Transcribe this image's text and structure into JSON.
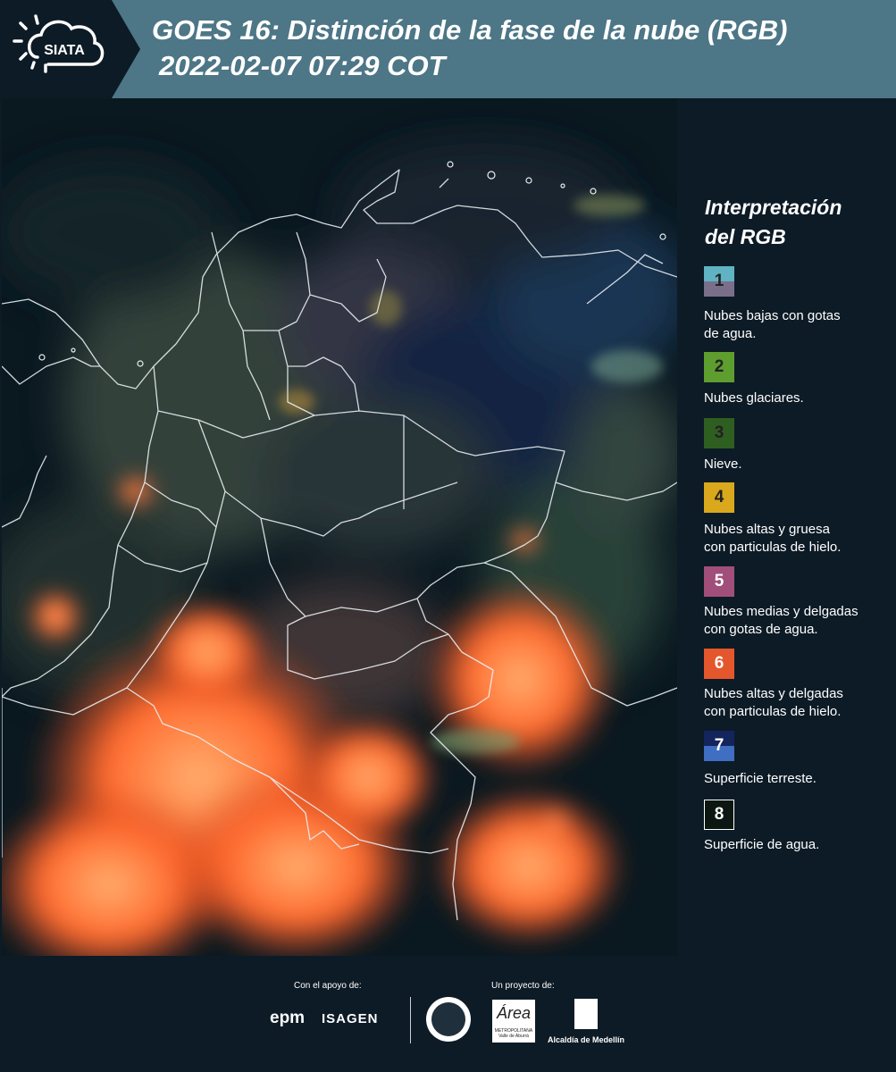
{
  "header": {
    "logo_text": "SIATA",
    "title_line1": "GOES 16: Distinción de la fase de la nube (RGB)",
    "title_line2": "2022-02-07 07:29 COT"
  },
  "legend": {
    "title_line1": "Interpretación",
    "title_line2": "del RGB",
    "items": [
      {
        "number": "1",
        "label_lines": [
          "Nubes bajas con gotas",
          "de agua."
        ],
        "colors": [
          "#5fb3c2",
          "#7a6f8b"
        ]
      },
      {
        "number": "2",
        "label_lines": [
          "Nubes glaciares."
        ],
        "colors": [
          "#5e9e2e"
        ]
      },
      {
        "number": "3",
        "label_lines": [
          "Nieve."
        ],
        "colors": [
          "#2f5e21"
        ]
      },
      {
        "number": "4",
        "label_lines": [
          "Nubes altas y gruesa",
          "con particulas de hielo."
        ],
        "colors": [
          "#d9a81c"
        ]
      },
      {
        "number": "5",
        "label_lines": [
          "Nubes medias y delgadas",
          "con gotas de agua."
        ],
        "colors": [
          "#a14f7a"
        ]
      },
      {
        "number": "6",
        "label_lines": [
          "Nubes altas y delgadas",
          "con particulas de hielo."
        ],
        "colors": [
          "#e4562c"
        ]
      },
      {
        "number": "7",
        "label_lines": [
          "Superficie terreste."
        ],
        "colors": [
          "#14255e",
          "#3f6ec2"
        ]
      },
      {
        "number": "8",
        "label_lines": [
          "Superficie de agua."
        ],
        "colors": [
          "#0b1710"
        ]
      }
    ]
  },
  "footer": {
    "support_label": "Con el apoyo de:",
    "project_label": "Un proyecto de:",
    "sponsor1": "epm",
    "sponsor2": "ISAGEN",
    "area_logo": "Área",
    "area_subtext": "METROPOLITANA Valle de Aburrá",
    "alcaldia": "Alcaldía de Medellín"
  },
  "colors": {
    "header_bg": "#4d7686",
    "panel_bg": "#0d1b26",
    "cloud_orange": "#ff6a2e"
  }
}
